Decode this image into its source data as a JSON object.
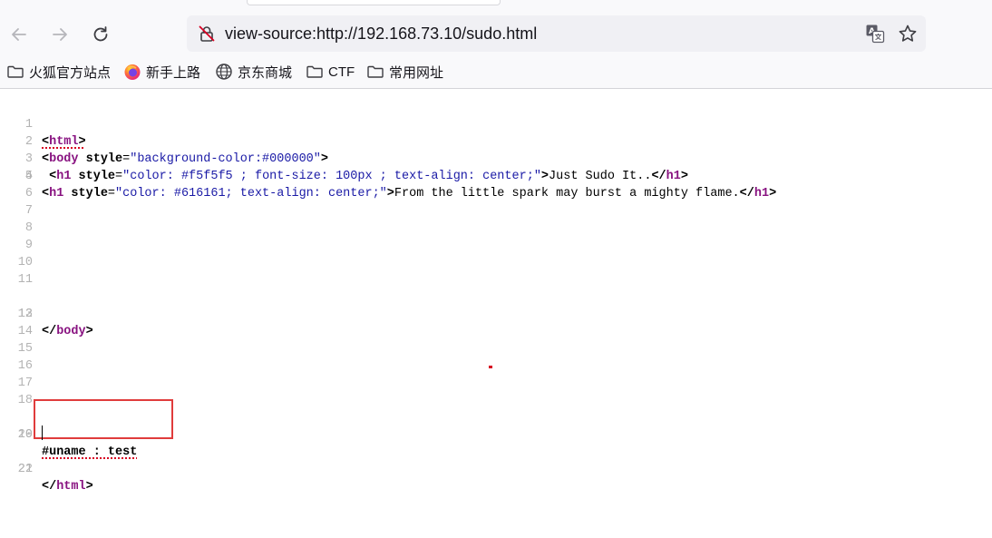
{
  "toolbar": {
    "back_icon": "arrow-left-icon",
    "forward_icon": "arrow-right-icon",
    "reload_icon": "reload-icon"
  },
  "urlbar": {
    "url": "view-source:http://192.168.73.10/sudo.html",
    "lock_icon": "insecure-lock-icon",
    "translate_icon": "translate-icon",
    "bookmark_icon": "star-icon"
  },
  "bookmarks": [
    {
      "label": "火狐官方站点",
      "icon": "folder-icon"
    },
    {
      "label": "新手上路",
      "icon": "firefox-icon"
    },
    {
      "label": "京东商城",
      "icon": "globe-icon"
    },
    {
      "label": "CTF",
      "icon": "folder-icon"
    },
    {
      "label": "常用网址",
      "icon": "folder-icon"
    }
  ],
  "source": {
    "line_numbers": [
      "1",
      "2",
      "3",
      "4",
      "5",
      "6",
      "7",
      "8",
      "9",
      "10",
      "11",
      "12",
      "13",
      "14",
      "15",
      "16",
      "17",
      "18",
      "19",
      "20",
      "21",
      "22"
    ],
    "l1": {
      "lt": "<",
      "tag": "html",
      "gt": ">"
    },
    "l2": {
      "lt": "<",
      "tag": "body",
      "attr": " style",
      "eq": "=",
      "val": "\"background-color:#000000\"",
      "gt": ">"
    },
    "l3": {
      "lead": " ",
      "lt": "<",
      "tag": "h1",
      "attr": " style",
      "eq": "=",
      "val": "\"color: #f5f5f5 ; font-size: 100px ; text-align: center;\"",
      "gt": ">",
      "text": "Just Sudo It..",
      "close_lt": "</",
      "close_tag": "h1",
      "close_gt": ">"
    },
    "l4": {
      "lt": "<",
      "tag": "h1",
      "attr": " style",
      "eq": "=",
      "val": "\"color: #616161; text-align: center;\"",
      "gt": ">",
      "text": "From the little spark may burst a mighty flame.",
      "close_lt": "</",
      "close_tag": "h1",
      "close_gt": ">"
    },
    "l12": {
      "lt": "</",
      "tag": "body",
      "gt": ">"
    },
    "l19": {
      "text": "#uname : test"
    },
    "l21": {
      "lt": "</",
      "tag": "html",
      "gt": ">"
    }
  }
}
